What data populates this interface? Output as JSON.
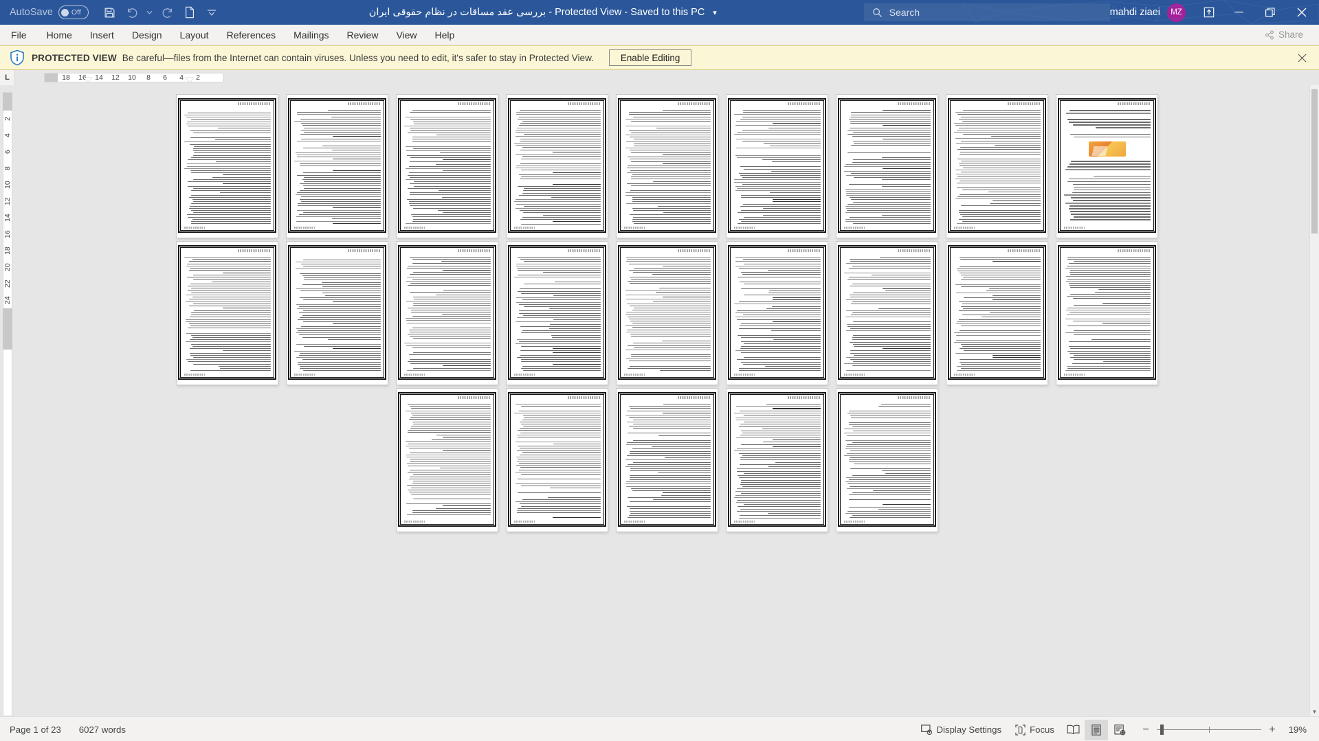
{
  "titlebar": {
    "autosave_label": "AutoSave",
    "autosave_state": "Off",
    "save_icon": "save-icon",
    "undo_icon": "undo-icon",
    "undo_more_icon": "chevron-down-icon",
    "redo_icon": "redo-icon",
    "new_icon": "new-document-icon",
    "customize_icon": "customize-quick-access-icon",
    "document_title": "بررسی عقد مساقات در نظام حقوقی ایران  -  Protected View  -  Saved to this PC",
    "title_dropdown_icon": "chevron-down-icon",
    "search_placeholder": "Search",
    "search_icon": "search-icon",
    "account_name": "mahdi ziaei",
    "account_initials": "MZ",
    "ribbon_display_icon": "ribbon-display-options-icon",
    "minimize_icon": "minimize-icon",
    "restore_icon": "restore-icon",
    "close_icon": "close-icon",
    "brand_color": "#2b579a",
    "avatar_color": "#a4219b"
  },
  "ribbon": {
    "tabs": [
      {
        "label": "File"
      },
      {
        "label": "Home"
      },
      {
        "label": "Insert"
      },
      {
        "label": "Design"
      },
      {
        "label": "Layout"
      },
      {
        "label": "References"
      },
      {
        "label": "Mailings"
      },
      {
        "label": "Review"
      },
      {
        "label": "View"
      },
      {
        "label": "Help"
      }
    ],
    "share_label": "Share",
    "share_icon": "share-icon"
  },
  "protected_view": {
    "icon": "shield-info-icon",
    "strong": "PROTECTED VIEW",
    "message": "Be careful—files from the Internet can contain viruses. Unless you need to edit, it's safer to stay in Protected View.",
    "enable_label": "Enable Editing",
    "close_icon": "close-icon",
    "bg_color": "#fbf6d6"
  },
  "ruler": {
    "tab_selector_glyph": "L",
    "horizontal_numbers": [
      "18",
      "16",
      "14",
      "12",
      "10",
      "8",
      "6",
      "4",
      "2"
    ],
    "vertical_numbers": [
      "2",
      "2",
      "4",
      "6",
      "8",
      "10",
      "12",
      "14",
      "16",
      "18",
      "20",
      "22",
      "24"
    ]
  },
  "document": {
    "total_pages": 23,
    "columns": 9,
    "rows": 3,
    "pages_in_row": [
      9,
      9,
      5
    ],
    "image_page_index": 8,
    "direction": "rtl"
  },
  "status": {
    "page_label": "Page 1 of 23",
    "word_count": "6027 words",
    "display_settings_label": "Display Settings",
    "display_settings_icon": "display-settings-icon",
    "focus_label": "Focus",
    "focus_icon": "focus-mode-icon",
    "read_mode_icon": "read-mode-icon",
    "print_layout_icon": "print-layout-icon",
    "web_layout_icon": "web-layout-icon",
    "zoom_out_label": "−",
    "zoom_in_label": "+",
    "zoom_level": "19%"
  }
}
